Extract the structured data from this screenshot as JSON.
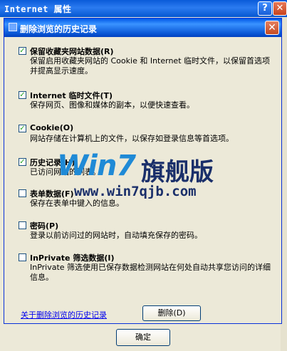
{
  "parent_window": {
    "title": "Internet 属性",
    "help_glyph": "?",
    "close_glyph": "✕",
    "ok_label": "确定"
  },
  "dialog": {
    "title": "删除浏览的历史记录",
    "close_glyph": "✕",
    "options": [
      {
        "label": "保留收藏夹网站数据(R)",
        "checked": true,
        "desc": "保留启用收藏夹网站的 Cookie 和 Internet 临时文件，以保留首选项并提高显示速度。"
      },
      {
        "label": "Internet 临时文件(T)",
        "checked": true,
        "desc": "保存网页、图像和媒体的副本，以便快速查看。"
      },
      {
        "label": "Cookie(O)",
        "checked": true,
        "desc": "网站存储在计算机上的文件，以保存如登录信息等首选项。"
      },
      {
        "label": "历史记录(H)",
        "checked": true,
        "desc": "已访问网站的列表。"
      },
      {
        "label": "表单数据(F)",
        "checked": false,
        "desc": "保存在表单中键入的信息。"
      },
      {
        "label": "密码(P)",
        "checked": false,
        "desc": "登录以前访问过的网站时，自动填充保存的密码。"
      },
      {
        "label": "InPrivate 筛选数据(I)",
        "checked": false,
        "desc": "InPrivate 筛选使用已保存数据检测网站在何处自动共享您访问的详细信息。"
      }
    ],
    "about_link": "关于删除浏览的历史记录",
    "delete_label": "删除(D)"
  },
  "watermark": {
    "logo": "Win7",
    "text": "旗舰版",
    "url": "www.win7qjb.com"
  }
}
